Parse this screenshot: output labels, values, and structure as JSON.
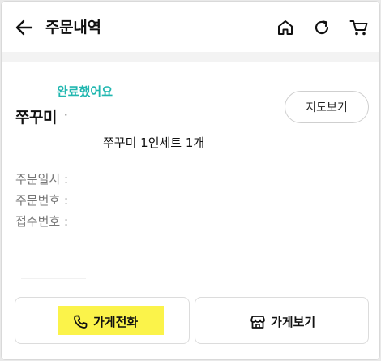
{
  "header": {
    "title": "주문내역",
    "icons": [
      "back-arrow-icon",
      "home-icon",
      "refresh-icon",
      "cart-icon"
    ]
  },
  "order": {
    "status": "완료했어요",
    "store_name": "쭈꾸미",
    "store_suffix": "·",
    "map_button": "지도보기",
    "menu_summary": "쭈꾸미 1인세트 1개",
    "info_labels": {
      "order_datetime": "주문일시 :",
      "order_number": "주문번호 :",
      "receipt_number": "접수번호 :"
    }
  },
  "actions": {
    "call_store": "가게전화",
    "view_store": "가게보기"
  },
  "colors": {
    "status": "#21b7b0",
    "highlight": "#fbf34a"
  }
}
